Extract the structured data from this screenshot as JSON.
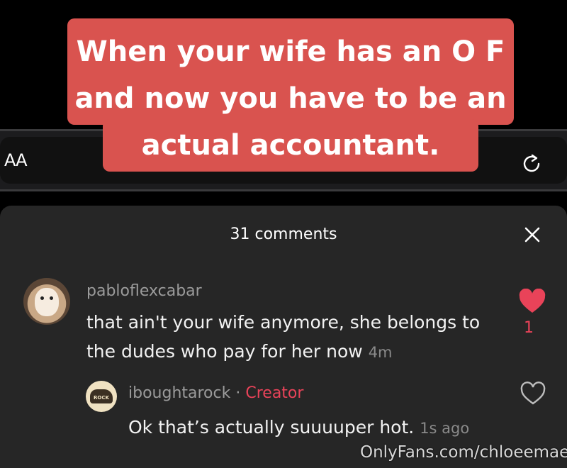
{
  "caption": {
    "text": "When your wife has an O F and now you have to be an actual accountant."
  },
  "browser": {
    "text_size_label": "AA"
  },
  "comments_panel": {
    "title": "31 comments",
    "comments": [
      {
        "username": "pabloflexcabar",
        "text": "that ain't your wife anymore, she belongs to the dudes who pay for her now",
        "time": "4m",
        "likes": "1",
        "liked": true
      }
    ],
    "replies": [
      {
        "username": "iboughtarock",
        "separator": "·",
        "badge": "Creator",
        "text": "Ok that’s actually suuuuper hot.",
        "time": "1s ago",
        "avatar_text": "ROCK",
        "liked": false
      }
    ]
  },
  "watermark": "OnlyFans.com/chloeemae",
  "colors": {
    "caption_bg": "#d9534f",
    "sheet_bg": "#262626",
    "accent_red": "#e94359"
  },
  "icons": [
    "close-icon",
    "heart-filled-icon",
    "heart-outline-icon",
    "reload-icon"
  ]
}
